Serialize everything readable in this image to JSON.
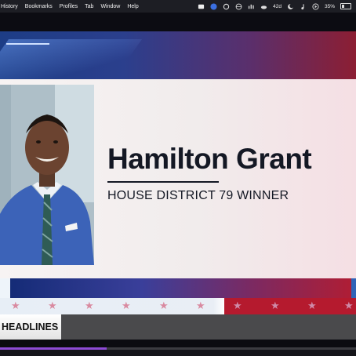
{
  "menubar": {
    "items": [
      "History",
      "Bookmarks",
      "Profiles",
      "Tab",
      "Window",
      "Help"
    ],
    "temperature": "42d",
    "battery": "35%"
  },
  "lower_third": {
    "name": "Hamilton Grant",
    "title": "HOUSE DISTRICT 79 WINNER"
  },
  "ticker": {
    "label": "HEADLINES"
  },
  "player": {
    "progress_fraction": 0.3
  },
  "colors": {
    "band_blue": "#1d3d86",
    "band_red": "#8c1e33",
    "progress": "#8e4bd6"
  }
}
